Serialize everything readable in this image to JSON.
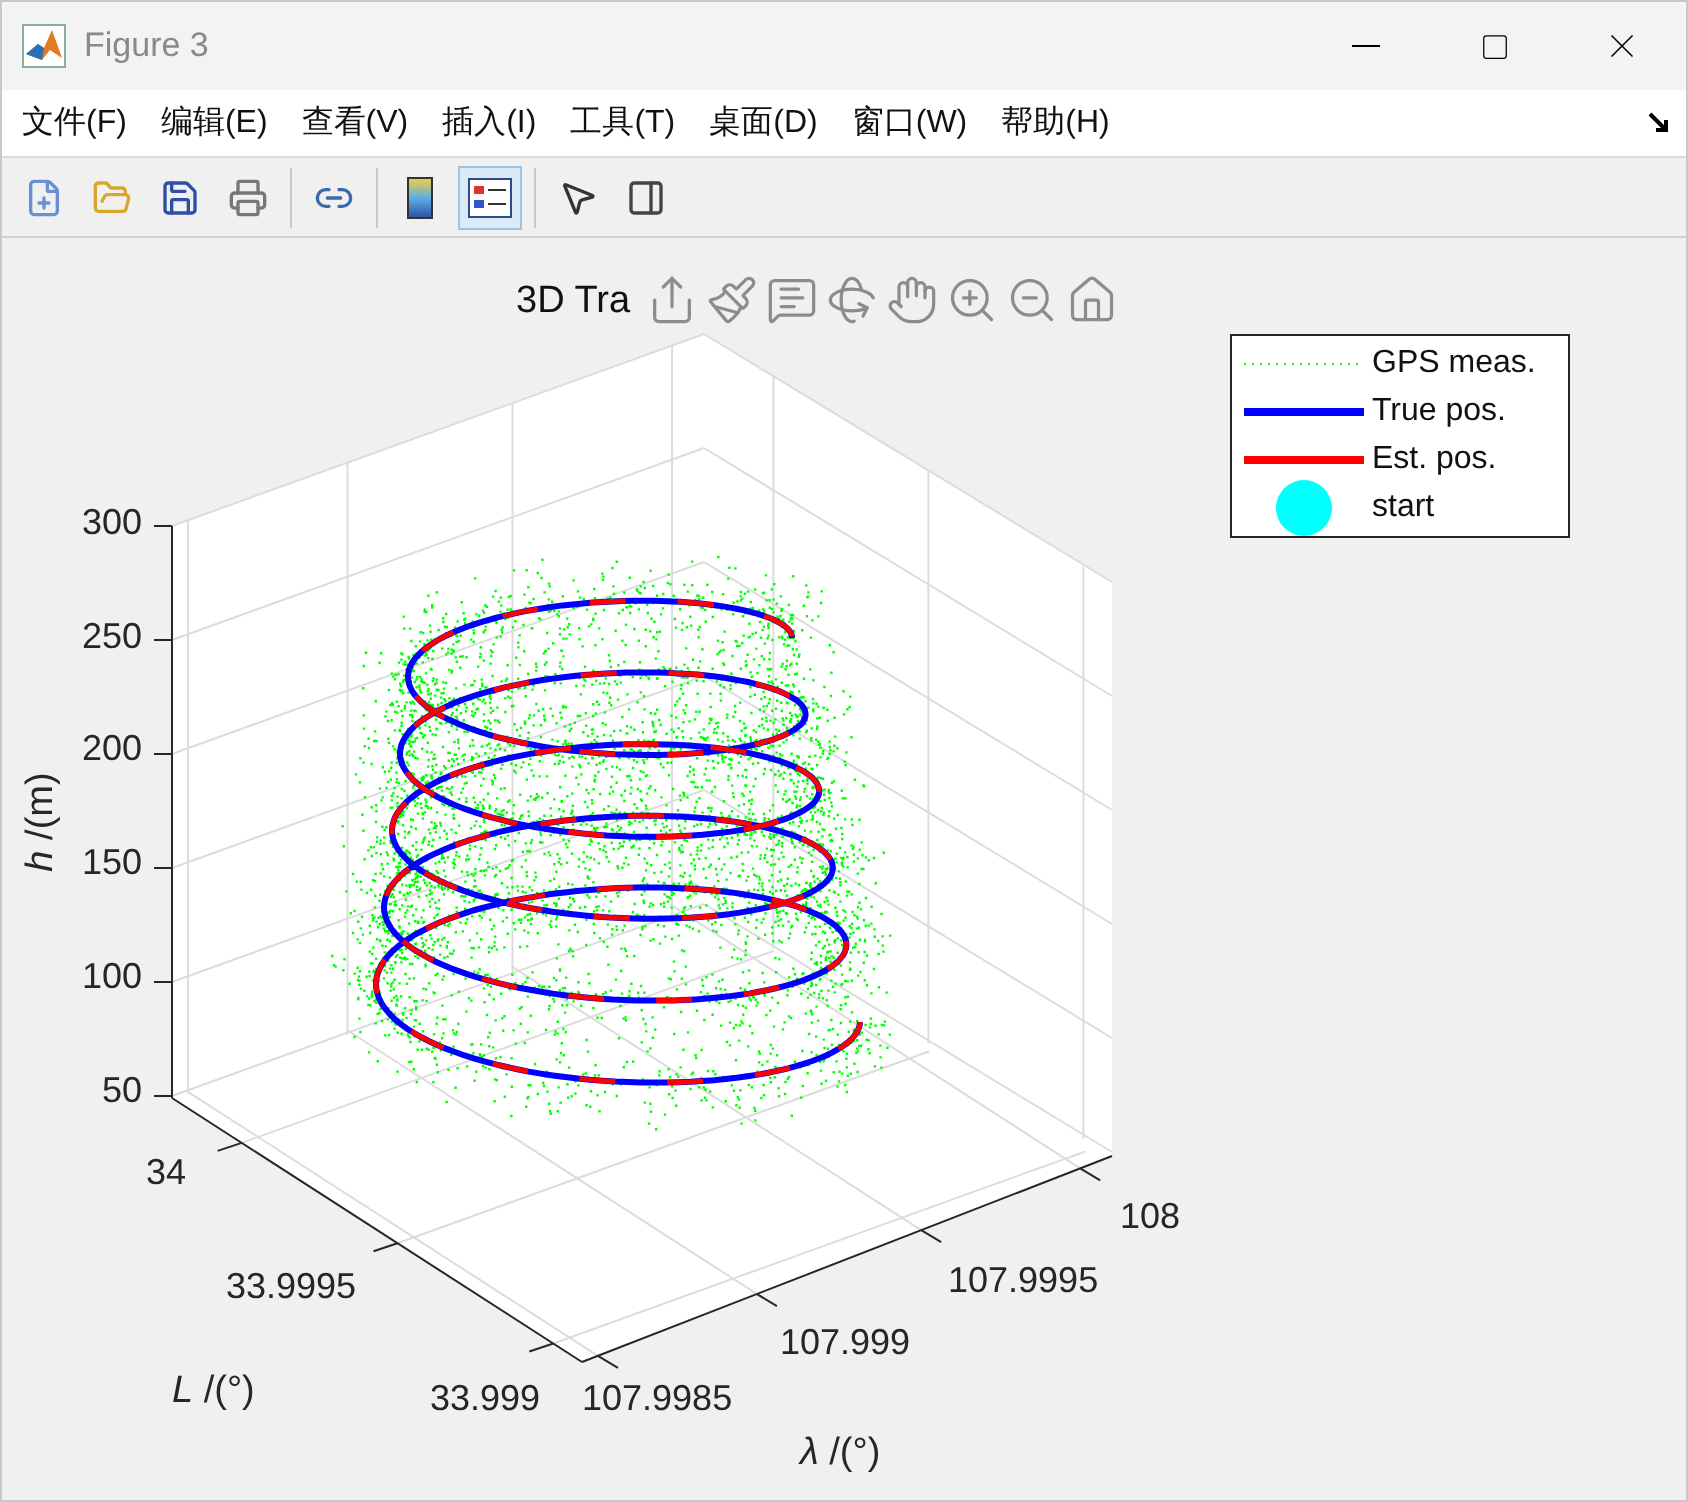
{
  "window": {
    "title": "Figure 3"
  },
  "menu": [
    "文件(F)",
    "编辑(E)",
    "查看(V)",
    "插入(I)",
    "工具(T)",
    "桌面(D)",
    "窗口(W)",
    "帮助(H)"
  ],
  "toolbar": [
    {
      "selected": false
    },
    {
      "selected": false
    },
    {
      "selected": false
    },
    {
      "selected": false
    },
    {
      "selected": false
    },
    {
      "selected": false
    },
    {
      "selected": true
    },
    {
      "selected": false
    },
    {
      "selected": false
    }
  ],
  "axes": {
    "title": "3D Tra",
    "zlabel": "*h* /(m)",
    "zticks": [
      "300",
      "250",
      "200",
      "150",
      "100",
      "50"
    ],
    "ylabel": "*L* /(°)",
    "yticks": [
      "34",
      "33.9995",
      "33.999"
    ],
    "xlabel": "*λ* /(°)",
    "xticks": [
      "107.9985",
      "107.999",
      "107.9995",
      "108"
    ]
  },
  "legend": [
    {
      "label": "GPS meas.",
      "kind": "dotted",
      "color": "#00ff00"
    },
    {
      "label": "True pos.",
      "kind": "line",
      "color": "#0000ff"
    },
    {
      "label": "Est. pos.",
      "kind": "line",
      "color": "#ff0000"
    },
    {
      "label": "start",
      "kind": "marker",
      "color": "#00ffff"
    }
  ]
}
